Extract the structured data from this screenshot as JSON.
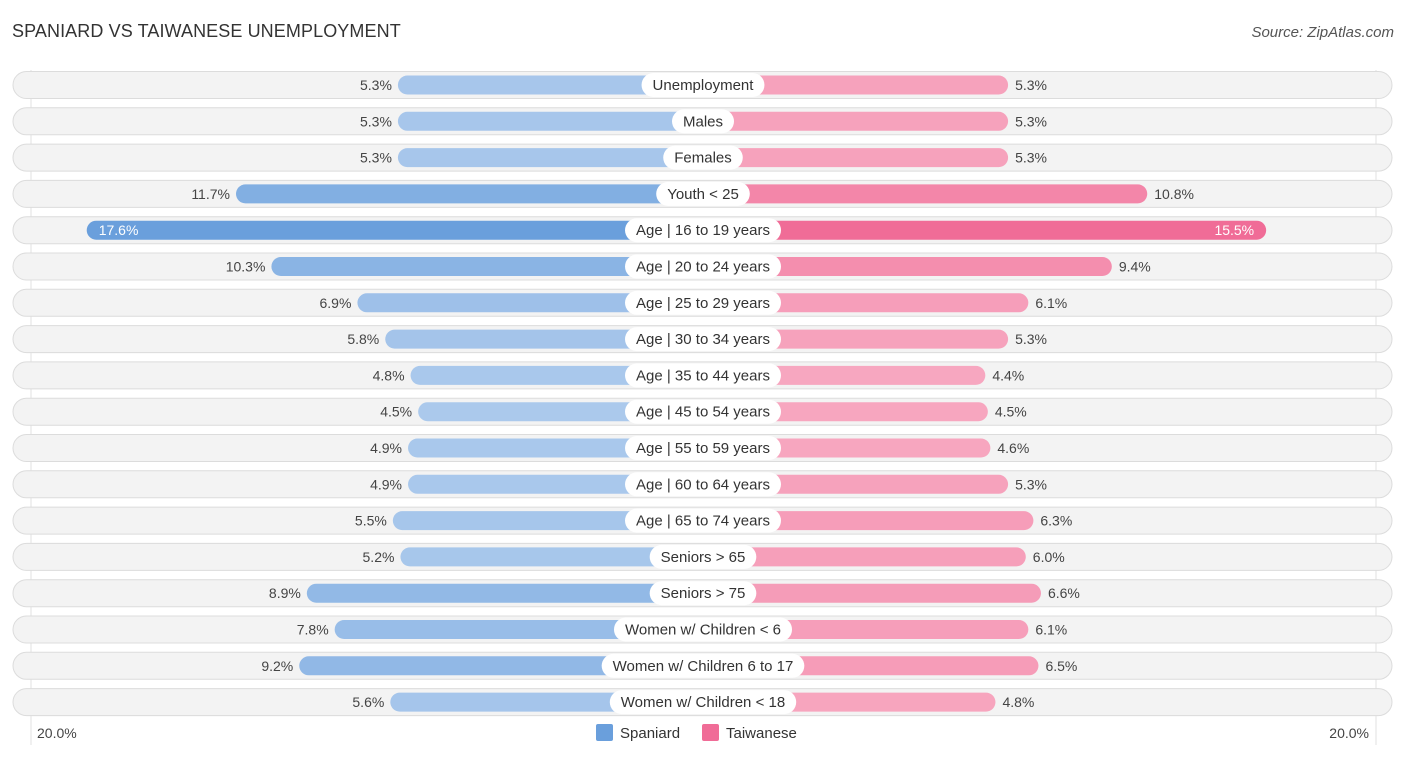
{
  "title": "SPANIARD VS TAIWANESE UNEMPLOYMENT",
  "source": "Source: ZipAtlas.com",
  "chart_data": {
    "type": "bar",
    "orientation": "horizontal-diverging",
    "title": "SPANIARD VS TAIWANESE UNEMPLOYMENT",
    "categories": [
      "Unemployment",
      "Males",
      "Females",
      "Youth < 25",
      "Age | 16 to 19 years",
      "Age | 20 to 24 years",
      "Age | 25 to 29 years",
      "Age | 30 to 34 years",
      "Age | 35 to 44 years",
      "Age | 45 to 54 years",
      "Age | 55 to 59 years",
      "Age | 60 to 64 years",
      "Age | 65 to 74 years",
      "Seniors > 65",
      "Seniors > 75",
      "Women w/ Children < 6",
      "Women w/ Children 6 to 17",
      "Women w/ Children < 18"
    ],
    "series": [
      {
        "name": "Spaniard",
        "side": "left",
        "color": "#6a9fdc",
        "values": [
          5.3,
          5.3,
          5.3,
          11.7,
          17.6,
          10.3,
          6.9,
          5.8,
          4.8,
          4.5,
          4.9,
          4.9,
          5.5,
          5.2,
          8.9,
          7.8,
          9.2,
          5.6
        ]
      },
      {
        "name": "Taiwanese",
        "side": "right",
        "color": "#f06c97",
        "values": [
          5.3,
          5.3,
          5.3,
          10.8,
          15.5,
          9.4,
          6.1,
          5.3,
          4.4,
          4.5,
          4.6,
          5.3,
          6.3,
          6.0,
          6.6,
          6.1,
          6.5,
          4.8
        ]
      }
    ],
    "value_suffix": "%",
    "axis": {
      "left_label": "20.0%",
      "right_label": "20.0%",
      "max": 20.0
    },
    "legend": {
      "position": "bottom-center",
      "items": [
        "Spaniard",
        "Taiwanese"
      ]
    }
  }
}
